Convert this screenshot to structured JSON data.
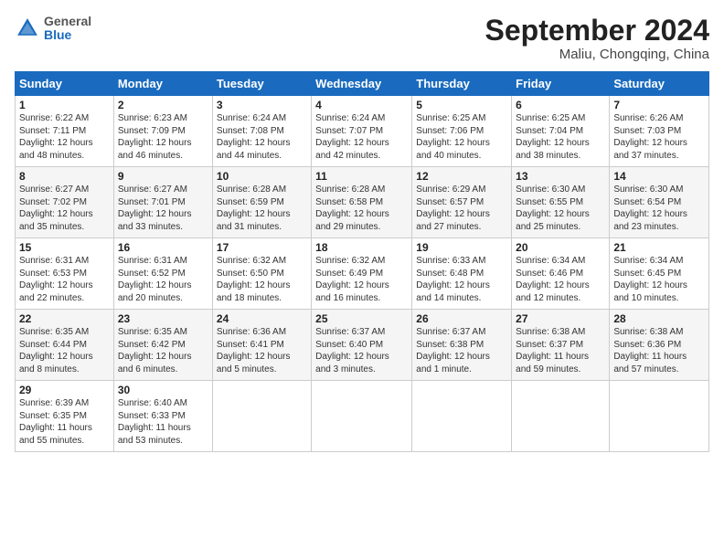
{
  "header": {
    "logo_general": "General",
    "logo_blue": "Blue",
    "month_title": "September 2024",
    "location": "Maliu, Chongqing, China"
  },
  "weekdays": [
    "Sunday",
    "Monday",
    "Tuesday",
    "Wednesday",
    "Thursday",
    "Friday",
    "Saturday"
  ],
  "weeks": [
    [
      {
        "day": "1",
        "info": "Sunrise: 6:22 AM\nSunset: 7:11 PM\nDaylight: 12 hours\nand 48 minutes."
      },
      {
        "day": "2",
        "info": "Sunrise: 6:23 AM\nSunset: 7:09 PM\nDaylight: 12 hours\nand 46 minutes."
      },
      {
        "day": "3",
        "info": "Sunrise: 6:24 AM\nSunset: 7:08 PM\nDaylight: 12 hours\nand 44 minutes."
      },
      {
        "day": "4",
        "info": "Sunrise: 6:24 AM\nSunset: 7:07 PM\nDaylight: 12 hours\nand 42 minutes."
      },
      {
        "day": "5",
        "info": "Sunrise: 6:25 AM\nSunset: 7:06 PM\nDaylight: 12 hours\nand 40 minutes."
      },
      {
        "day": "6",
        "info": "Sunrise: 6:25 AM\nSunset: 7:04 PM\nDaylight: 12 hours\nand 38 minutes."
      },
      {
        "day": "7",
        "info": "Sunrise: 6:26 AM\nSunset: 7:03 PM\nDaylight: 12 hours\nand 37 minutes."
      }
    ],
    [
      {
        "day": "8",
        "info": "Sunrise: 6:27 AM\nSunset: 7:02 PM\nDaylight: 12 hours\nand 35 minutes."
      },
      {
        "day": "9",
        "info": "Sunrise: 6:27 AM\nSunset: 7:01 PM\nDaylight: 12 hours\nand 33 minutes."
      },
      {
        "day": "10",
        "info": "Sunrise: 6:28 AM\nSunset: 6:59 PM\nDaylight: 12 hours\nand 31 minutes."
      },
      {
        "day": "11",
        "info": "Sunrise: 6:28 AM\nSunset: 6:58 PM\nDaylight: 12 hours\nand 29 minutes."
      },
      {
        "day": "12",
        "info": "Sunrise: 6:29 AM\nSunset: 6:57 PM\nDaylight: 12 hours\nand 27 minutes."
      },
      {
        "day": "13",
        "info": "Sunrise: 6:30 AM\nSunset: 6:55 PM\nDaylight: 12 hours\nand 25 minutes."
      },
      {
        "day": "14",
        "info": "Sunrise: 6:30 AM\nSunset: 6:54 PM\nDaylight: 12 hours\nand 23 minutes."
      }
    ],
    [
      {
        "day": "15",
        "info": "Sunrise: 6:31 AM\nSunset: 6:53 PM\nDaylight: 12 hours\nand 22 minutes."
      },
      {
        "day": "16",
        "info": "Sunrise: 6:31 AM\nSunset: 6:52 PM\nDaylight: 12 hours\nand 20 minutes."
      },
      {
        "day": "17",
        "info": "Sunrise: 6:32 AM\nSunset: 6:50 PM\nDaylight: 12 hours\nand 18 minutes."
      },
      {
        "day": "18",
        "info": "Sunrise: 6:32 AM\nSunset: 6:49 PM\nDaylight: 12 hours\nand 16 minutes."
      },
      {
        "day": "19",
        "info": "Sunrise: 6:33 AM\nSunset: 6:48 PM\nDaylight: 12 hours\nand 14 minutes."
      },
      {
        "day": "20",
        "info": "Sunrise: 6:34 AM\nSunset: 6:46 PM\nDaylight: 12 hours\nand 12 minutes."
      },
      {
        "day": "21",
        "info": "Sunrise: 6:34 AM\nSunset: 6:45 PM\nDaylight: 12 hours\nand 10 minutes."
      }
    ],
    [
      {
        "day": "22",
        "info": "Sunrise: 6:35 AM\nSunset: 6:44 PM\nDaylight: 12 hours\nand 8 minutes."
      },
      {
        "day": "23",
        "info": "Sunrise: 6:35 AM\nSunset: 6:42 PM\nDaylight: 12 hours\nand 6 minutes."
      },
      {
        "day": "24",
        "info": "Sunrise: 6:36 AM\nSunset: 6:41 PM\nDaylight: 12 hours\nand 5 minutes."
      },
      {
        "day": "25",
        "info": "Sunrise: 6:37 AM\nSunset: 6:40 PM\nDaylight: 12 hours\nand 3 minutes."
      },
      {
        "day": "26",
        "info": "Sunrise: 6:37 AM\nSunset: 6:38 PM\nDaylight: 12 hours\nand 1 minute."
      },
      {
        "day": "27",
        "info": "Sunrise: 6:38 AM\nSunset: 6:37 PM\nDaylight: 11 hours\nand 59 minutes."
      },
      {
        "day": "28",
        "info": "Sunrise: 6:38 AM\nSunset: 6:36 PM\nDaylight: 11 hours\nand 57 minutes."
      }
    ],
    [
      {
        "day": "29",
        "info": "Sunrise: 6:39 AM\nSunset: 6:35 PM\nDaylight: 11 hours\nand 55 minutes."
      },
      {
        "day": "30",
        "info": "Sunrise: 6:40 AM\nSunset: 6:33 PM\nDaylight: 11 hours\nand 53 minutes."
      },
      null,
      null,
      null,
      null,
      null
    ]
  ]
}
